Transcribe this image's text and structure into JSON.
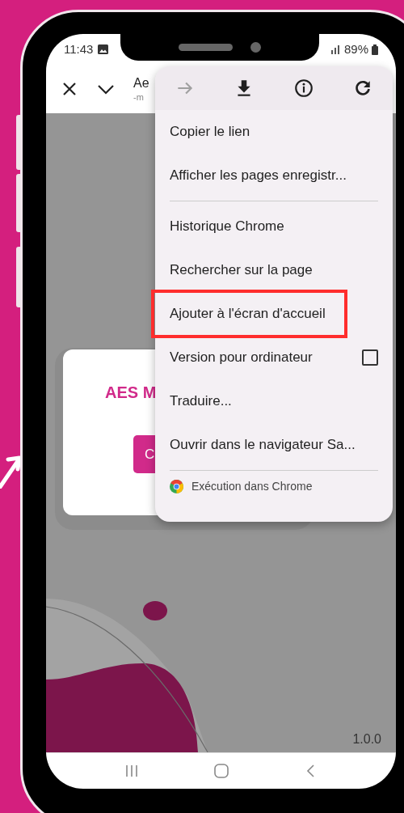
{
  "status_bar": {
    "time": "11:43",
    "battery": "89%"
  },
  "toolbar": {
    "title": "Ae",
    "url": "-m"
  },
  "page": {
    "card_title": "AES M",
    "card_button": "C",
    "version": "1.0.0"
  },
  "menu": {
    "icons": [
      {
        "kind": "forward",
        "disabled": true
      },
      {
        "kind": "download",
        "disabled": false
      },
      {
        "kind": "info",
        "disabled": false
      },
      {
        "kind": "reload",
        "disabled": false
      }
    ],
    "sections": [
      {
        "items": [
          {
            "label": "Copier le lien",
            "highlighted": false
          },
          {
            "label": "Afficher les pages enregistr...",
            "highlighted": false
          }
        ]
      },
      {
        "items": [
          {
            "label": "Historique Chrome",
            "highlighted": false
          },
          {
            "label": "Rechercher sur la page",
            "highlighted": false
          },
          {
            "label": "Ajouter à l'écran d'accueil",
            "highlighted": true
          },
          {
            "label": "Version pour ordinateur",
            "highlighted": false,
            "checked": false
          },
          {
            "label": "Traduire...",
            "highlighted": false
          },
          {
            "label": "Ouvrir dans le navigateur Sa...",
            "highlighted": false
          }
        ]
      }
    ],
    "footer": "Exécution dans Chrome"
  }
}
